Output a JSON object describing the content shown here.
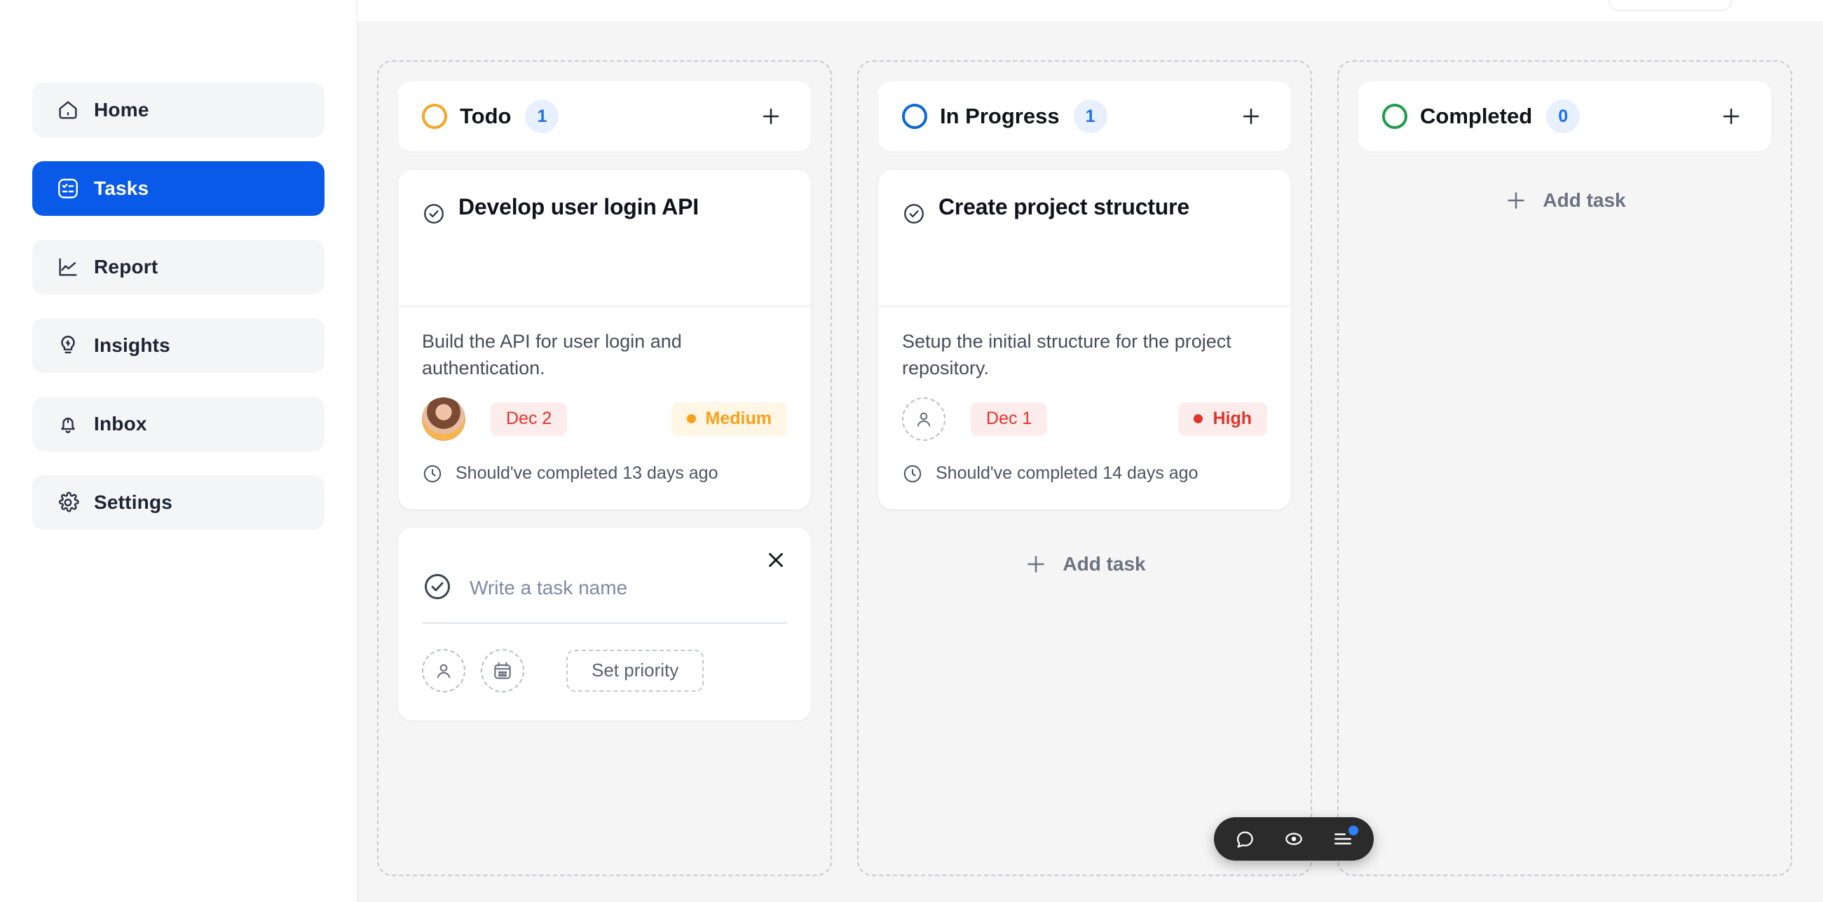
{
  "sidebar": {
    "items": [
      {
        "label": "Home",
        "icon": "home-icon",
        "active": false
      },
      {
        "label": "Tasks",
        "icon": "tasks-icon",
        "active": true
      },
      {
        "label": "Report",
        "icon": "chart-icon",
        "active": false
      },
      {
        "label": "Insights",
        "icon": "lightbulb-icon",
        "active": false
      },
      {
        "label": "Inbox",
        "icon": "bell-icon",
        "active": false
      },
      {
        "label": "Settings",
        "icon": "gear-icon",
        "active": false
      }
    ]
  },
  "board": {
    "add_task_label": "Add task",
    "columns": [
      {
        "title": "Todo",
        "count": "1",
        "status_color": "#f5a623",
        "add_label": "Add task"
      },
      {
        "title": "In Progress",
        "count": "1",
        "status_color": "#0a6ad1",
        "add_label": "Add task"
      },
      {
        "title": "Completed",
        "count": "0",
        "status_color": "#1f9d4d",
        "add_label": "Add task"
      }
    ]
  },
  "tasks": {
    "todo": {
      "title": "Develop user login API",
      "description": "Build the API for user login and authentication.",
      "date": "Dec 2",
      "priority": "Medium",
      "priority_color": "#f9a01b",
      "due_note": "Should've completed 13 days ago",
      "has_avatar": true
    },
    "in_progress": {
      "title": "Create project structure",
      "description": "Setup the initial structure for the project repository.",
      "date": "Dec 1",
      "priority": "High",
      "priority_color": "#e0352b",
      "due_note": "Should've completed 14 days ago",
      "has_avatar": false
    }
  },
  "composer": {
    "placeholder": "Write a task name",
    "set_priority_label": "Set priority"
  },
  "toolbar": {
    "items": [
      "comment-icon",
      "eye-icon",
      "menu-lines-icon"
    ],
    "badge_color": "#2f80ff"
  },
  "colors": {
    "accent": "#0a5ae9",
    "board_bg": "#f5f5f6",
    "card_bg": "#ffffff",
    "dashed_border": "#c9cbcf"
  }
}
